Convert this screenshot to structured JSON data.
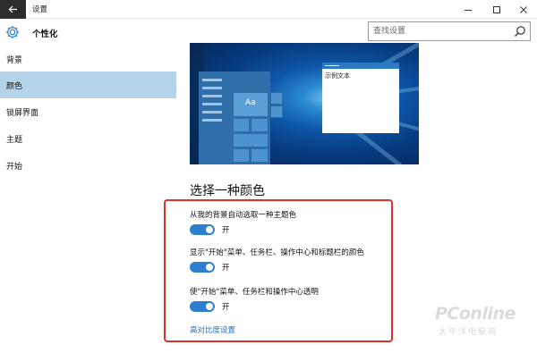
{
  "window": {
    "title": "设置",
    "back_icon": "back-arrow-icon",
    "controls": [
      "minimize-icon",
      "maximize-icon",
      "close-icon"
    ]
  },
  "header": {
    "icon": "gear-icon",
    "title": "个性化",
    "search": {
      "placeholder": "查找设置",
      "value": "",
      "icon": "search-icon"
    }
  },
  "sidebar": {
    "items": [
      {
        "label": "背景",
        "active": false
      },
      {
        "label": "颜色",
        "active": true
      },
      {
        "label": "锁屏界面",
        "active": false
      },
      {
        "label": "主题",
        "active": false
      },
      {
        "label": "开始",
        "active": false
      }
    ]
  },
  "preview": {
    "tile_label": "Aa",
    "sample_text": "示例文本"
  },
  "color_section": {
    "heading": "选择一种颜色",
    "options": [
      {
        "label": "从我的背景自动选取一种主题色",
        "toggle_on": true,
        "state": "开"
      },
      {
        "label": "显示\"开始\"菜单、任务栏、操作中心和标题栏的颜色",
        "toggle_on": true,
        "state": "开"
      },
      {
        "label": "使\"开始\"菜单、任务栏和操作中心透明",
        "toggle_on": true,
        "state": "开"
      }
    ],
    "link": "高对比度设置"
  },
  "watermark": {
    "text": "PConline",
    "subtext": "太平洋电脑网"
  },
  "colors": {
    "accent": "#2a7fd0",
    "sidebar_active": "#b4d3e8",
    "highlight_frame": "#d9322b",
    "link": "#2a6fb8"
  }
}
